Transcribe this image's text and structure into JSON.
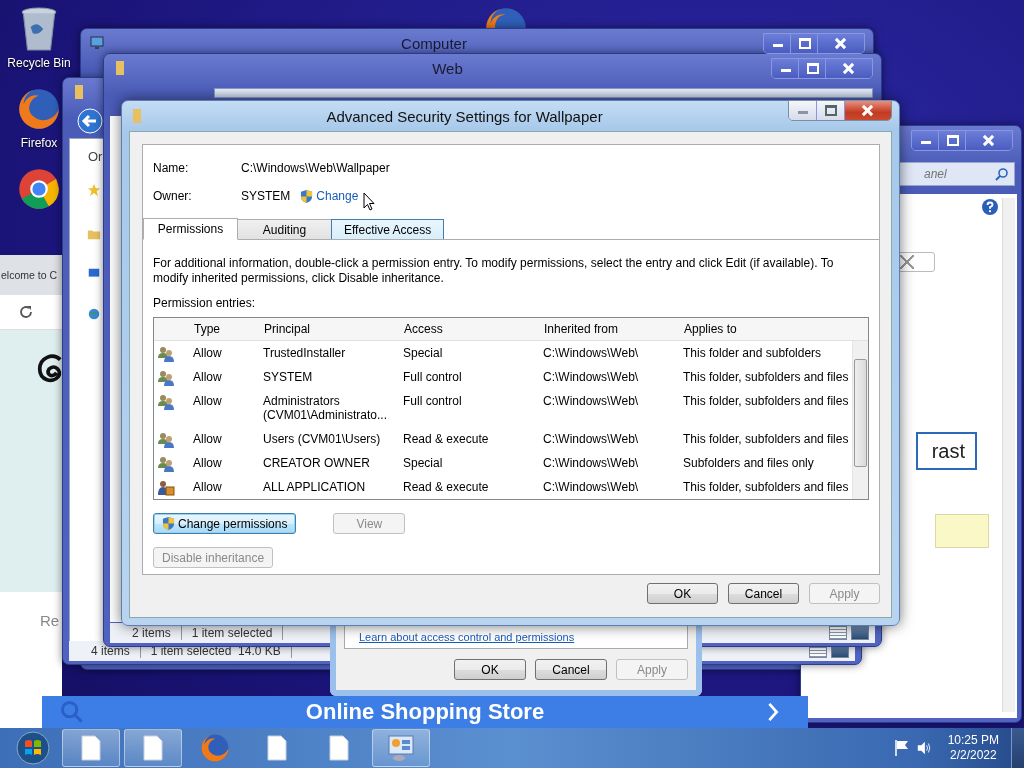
{
  "desktop": {
    "icons": [
      {
        "kind": "bin",
        "label": "Recycle Bin"
      },
      {
        "kind": "firefox",
        "label": "Firefox"
      },
      {
        "kind": "chrome"
      }
    ]
  },
  "windows": {
    "computer": {
      "title": "Computer"
    },
    "control_panel": {
      "search_placeholder": "anel",
      "button": "rast"
    },
    "chrome": {
      "tab": "elcome to C",
      "heading": "Re",
      "banner": "Online Shopping Store"
    },
    "explorer": {
      "nav_text": "Or",
      "status": [
        "4 items",
        "1 item selected  14.0 KB"
      ]
    },
    "web": {
      "title": "Web",
      "status": [
        "2 items",
        "1 item selected"
      ]
    },
    "properties": {
      "link": "Learn about access control and permissions",
      "buttons": [
        {
          "label": "OK",
          "disabled": false
        },
        {
          "label": "Cancel",
          "disabled": false
        },
        {
          "label": "Apply",
          "disabled": true
        }
      ]
    }
  },
  "dialog": {
    "title": "Advanced Security Settings for Wallpaper",
    "name_label": "Name:",
    "name_value": "C:\\Windows\\Web\\Wallpaper",
    "owner_label": "Owner:",
    "owner_value": "SYSTEM",
    "change_link": "Change",
    "tabs": [
      {
        "label": "Permissions",
        "selected": true,
        "hot": false
      },
      {
        "label": "Auditing",
        "selected": false,
        "hot": false
      },
      {
        "label": "Effective Access",
        "selected": false,
        "hot": true
      }
    ],
    "info": "For additional information, double-click a permission entry. To modify permissions, select the entry and click Edit (if available). To modify inherited permissions, click Disable inheritance.",
    "entries_label": "Permission entries:",
    "columns": [
      "Type",
      "Principal",
      "Access",
      "Inherited from",
      "Applies to"
    ],
    "rows": [
      {
        "kind": "group",
        "type": "Allow",
        "principal": "TrustedInstaller",
        "access": "Special",
        "inherited": "C:\\Windows\\Web\\",
        "applies": "This folder and subfolders"
      },
      {
        "kind": "group",
        "type": "Allow",
        "principal": "SYSTEM",
        "access": "Full control",
        "inherited": "C:\\Windows\\Web\\",
        "applies": "This folder, subfolders and files"
      },
      {
        "kind": "group",
        "type": "Allow",
        "principal": "Administrators (CVM01\\Administrato...",
        "access": "Full control",
        "inherited": "C:\\Windows\\Web\\",
        "applies": "This folder, subfolders and files"
      },
      {
        "kind": "group",
        "type": "Allow",
        "principal": "Users (CVM01\\Users)",
        "access": "Read & execute",
        "inherited": "C:\\Windows\\Web\\",
        "applies": "This folder, subfolders and files"
      },
      {
        "kind": "group",
        "type": "Allow",
        "principal": "CREATOR OWNER",
        "access": "Special",
        "inherited": "C:\\Windows\\Web\\",
        "applies": "Subfolders and files only"
      },
      {
        "kind": "app",
        "type": "Allow",
        "principal": "ALL APPLICATION",
        "access": "Read & execute",
        "inherited": "C:\\Windows\\Web\\",
        "applies": "This folder, subfolders and files"
      }
    ],
    "action_buttons": [
      {
        "label": "Change permissions",
        "disabled": false,
        "shield": true
      },
      {
        "label": "View",
        "disabled": true,
        "shield": false
      }
    ],
    "inheritance_button": {
      "label": "Disable inheritance",
      "disabled": true
    },
    "buttons": [
      {
        "label": "OK",
        "disabled": false
      },
      {
        "label": "Cancel",
        "disabled": false
      },
      {
        "label": "Apply",
        "disabled": true
      }
    ]
  },
  "taskbar": {
    "items": [
      {
        "kind": "file",
        "active": true
      },
      {
        "kind": "file",
        "active": true
      },
      {
        "kind": "firefox",
        "active": false
      },
      {
        "kind": "file",
        "active": false
      },
      {
        "kind": "file",
        "active": false
      },
      {
        "kind": "control-panel",
        "active": true
      }
    ],
    "time": "10:25 PM",
    "date": "2/2/2022"
  }
}
